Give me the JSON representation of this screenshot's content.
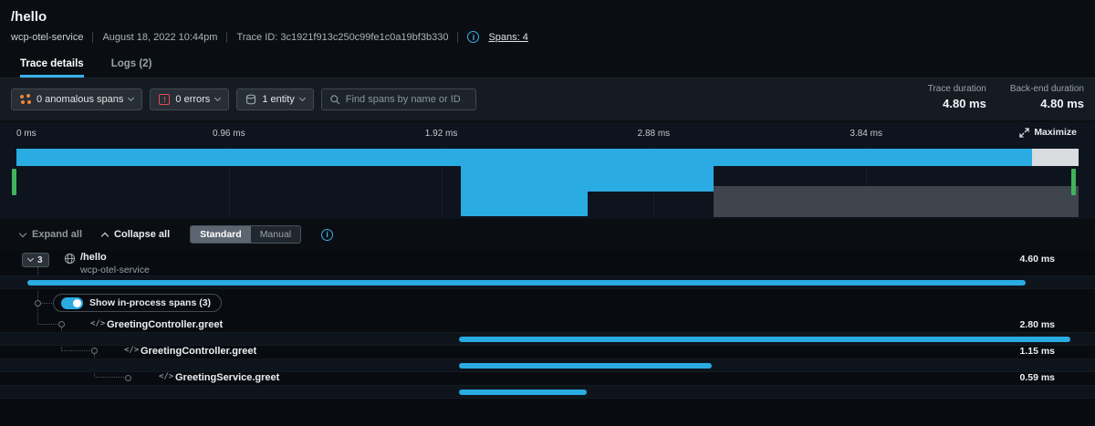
{
  "colors": {
    "accent_blue": "#2aabe2",
    "tab_underline_blue": "#3ab0ea",
    "selection_green": "#3fb45a",
    "error_red": "#e5484d",
    "anomaly_orange": "#f08536",
    "minimap_gray_bar": "#3f454c",
    "minimap_light_bar": "#d9dcdf"
  },
  "icons": {
    "code_glyph": "</>",
    "info_glyph": "i",
    "error_glyph": "!"
  },
  "header": {
    "title": "/hello",
    "service": "wcp-otel-service",
    "timestamp": "August 18, 2022 10:44pm",
    "trace_id": "Trace ID: 3c1921f913c250c99fe1c0a19bf3b330",
    "spans_count": "Spans: 4"
  },
  "tabs": {
    "trace_details": "Trace details",
    "logs": "Logs (2)"
  },
  "toolbar": {
    "anomalous_label": "0 anomalous spans",
    "errors_label": "0 errors",
    "entity_label": "1 entity",
    "search_placeholder": "Find spans by name or ID",
    "durations": [
      {
        "label": "Trace duration",
        "value": "4.80 ms"
      },
      {
        "label": "Back-end duration",
        "value": "4.80 ms"
      }
    ]
  },
  "minimap": {
    "ticks": [
      "0 ms",
      "0.96 ms",
      "1.92 ms",
      "2.88 ms",
      "3.84 ms"
    ],
    "maximize_label": "Maximize",
    "bars": [
      {
        "name": "root-span-bar",
        "color": "blue",
        "style": "left:0;width:95.6%;top:3px;height:19px"
      },
      {
        "name": "root-span-tail",
        "color": "light",
        "style": "left:95.6%;width:4.4%;top:3px;height:19px"
      },
      {
        "name": "child-span-bar-1",
        "color": "blue",
        "style": "left:41.8%;width:23.8%;top:22px;height:28px"
      },
      {
        "name": "child-span-bar-2",
        "color": "blue",
        "style": "left:41.8%;width:12%;top:50px;height:27px"
      },
      {
        "name": "self-time-bar",
        "color": "gray",
        "style": "left:65.6%;width:34.4%;top:44px;height:34px"
      }
    ]
  },
  "controls": {
    "expand_all": "Expand all",
    "collapse_all": "Collapse all",
    "modes": [
      "Standard",
      "Manual"
    ],
    "selected_mode": "Standard"
  },
  "waterfall": {
    "root": {
      "badge": "3",
      "name": "/hello",
      "service": "wcp-otel-service",
      "duration": "4.60 ms",
      "bar_style": "left:1%;width:94%"
    },
    "toggle_label": "Show in-process spans (3)",
    "spans": [
      {
        "name": "GreetingController.greet",
        "duration": "2.80 ms",
        "bar_style": "left:41.7%;width:57.5%"
      },
      {
        "name": "GreetingController.greet",
        "duration": "1.15 ms",
        "bar_style": "left:41.7%;width:23.8%"
      },
      {
        "name": "GreetingService.greet",
        "duration": "0.59 ms",
        "bar_style": "left:41.7%;width:12%"
      }
    ]
  }
}
